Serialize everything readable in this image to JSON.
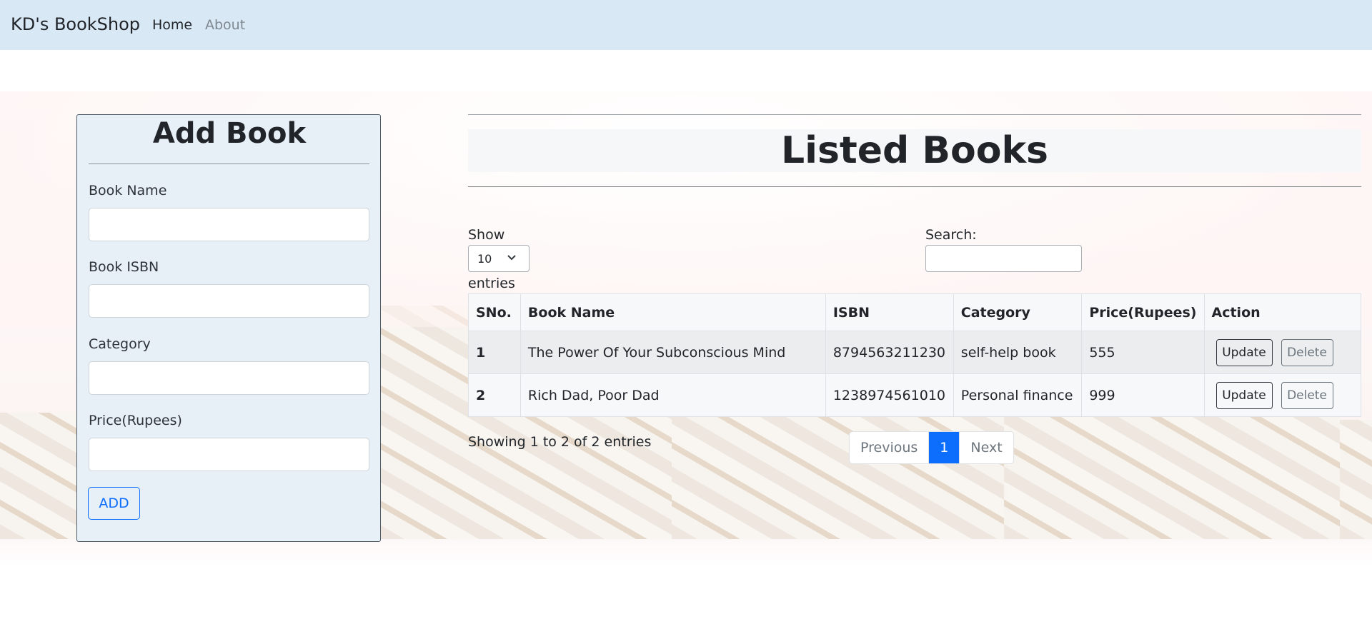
{
  "navbar": {
    "brand": "KD's BookShop",
    "links": [
      "Home",
      "About"
    ]
  },
  "add_book": {
    "title": "Add Book",
    "fields": [
      {
        "label": "Book Name",
        "value": ""
      },
      {
        "label": "Book ISBN",
        "value": ""
      },
      {
        "label": "Category",
        "value": ""
      },
      {
        "label": "Price(Rupees)",
        "value": ""
      }
    ],
    "add_label": "ADD"
  },
  "listed_books": {
    "title": "Listed Books",
    "show_label": "Show",
    "entries_value": "10",
    "entries_label": "entries",
    "search_label": "Search:",
    "search_value": "",
    "columns": [
      "SNo.",
      "Book Name",
      "ISBN",
      "Category",
      "Price(Rupees)",
      "Action"
    ],
    "rows": [
      {
        "sno": "1",
        "name": "The Power Of Your Subconscious Mind",
        "isbn": "8794563211230",
        "category": "self-help book",
        "price": "555"
      },
      {
        "sno": "2",
        "name": "Rich Dad, Poor Dad",
        "isbn": "1238974561010",
        "category": "Personal finance",
        "price": "999"
      }
    ],
    "update_label": "Update",
    "delete_label": "Delete",
    "info": "Showing 1 to 2 of 2 entries",
    "pagination": {
      "previous": "Previous",
      "current": "1",
      "next": "Next"
    }
  },
  "colors": {
    "navbar_bg": "#d8e8f5",
    "card_bg": "#e7eff7",
    "primary": "#0d6efd"
  }
}
